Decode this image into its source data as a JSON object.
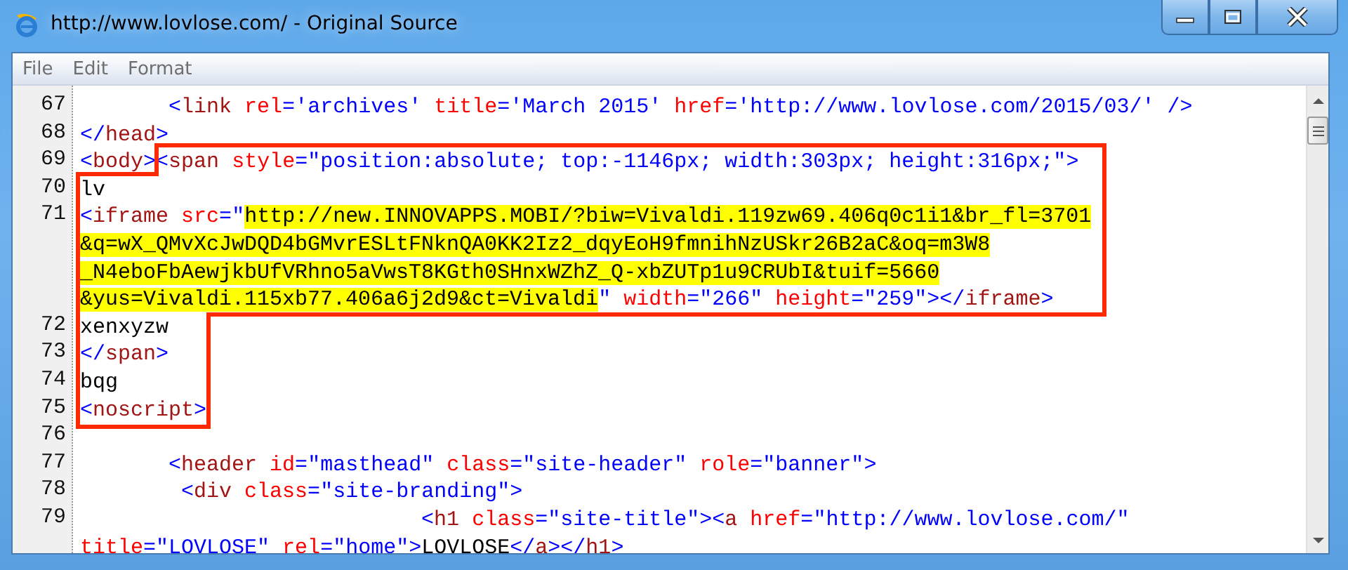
{
  "window": {
    "title": "http://www.lovlose.com/ - Original Source"
  },
  "menu": [
    "File",
    "Edit",
    "Format"
  ],
  "code_rows": [
    {
      "number": "67",
      "segments": [
        {
          "kind": "punct",
          "s": "<"
        },
        {
          "kind": "tag",
          "s": "link"
        },
        {
          "kind": "attr",
          "s": " rel"
        },
        {
          "kind": "punct",
          "s": "="
        },
        {
          "kind": "value",
          "s": "'archives'"
        },
        {
          "kind": "attr",
          "s": " title"
        },
        {
          "kind": "punct",
          "s": "="
        },
        {
          "kind": "value",
          "s": "'March 2015'"
        },
        {
          "kind": "attr",
          "s": " href"
        },
        {
          "kind": "punct",
          "s": "="
        },
        {
          "kind": "value",
          "s": "'http://www.lovlose.com/2015/03/'"
        },
        {
          "kind": "punct",
          "s": " />"
        }
      ]
    },
    {
      "number": "68",
      "segments": [
        {
          "kind": "punct",
          "s": "</"
        },
        {
          "kind": "tag",
          "s": "head"
        },
        {
          "kind": "punct",
          "s": ">"
        }
      ]
    },
    {
      "number": "69",
      "segments": [
        {
          "kind": "punct",
          "s": "<"
        },
        {
          "kind": "tag",
          "s": "body"
        },
        {
          "kind": "punct",
          "s": "><"
        },
        {
          "kind": "tag",
          "s": "span"
        },
        {
          "kind": "attr",
          "s": " style"
        },
        {
          "kind": "punct",
          "s": "="
        },
        {
          "kind": "value",
          "s": "\"position:absolute; top:-1146px; width:303px; height:316px;\""
        },
        {
          "kind": "punct",
          "s": ">"
        }
      ]
    },
    {
      "number": "70",
      "segments": [
        {
          "kind": "text",
          "s": "lv"
        }
      ]
    },
    {
      "number": "71",
      "segments": [
        {
          "kind": "punct",
          "s": "<"
        },
        {
          "kind": "tag",
          "s": "iframe"
        },
        {
          "kind": "attr",
          "s": " src"
        },
        {
          "kind": "punct",
          "s": "="
        },
        {
          "kind": "value",
          "s": "\""
        },
        {
          "kind": "highlight",
          "s": "http://new.INNOVAPPS.MOBI/?biw=Vivaldi.119zw69.406q0c1i1&br_fl=3701"
        }
      ]
    },
    {
      "segments": [
        {
          "kind": "highlight",
          "s": "&q=wX_QMvXcJwDQD4bGMvrESLtFNknQA0KK2Iz2_dqyEoH9fmnihNzUSkr26B2aC&oq=m3W8"
        }
      ]
    },
    {
      "segments": [
        {
          "kind": "highlight",
          "s": "_N4eboFbAewjkbUfVRhno5aVwsT8KGth0SHnxWZhZ_Q-xbZUTp1u9CRUbI&tuif=5660"
        }
      ]
    },
    {
      "segments": [
        {
          "kind": "highlight",
          "s": "&yus=Vivaldi.115xb77.406a6j2d9&ct=Vivaldi"
        },
        {
          "kind": "value",
          "s": "\""
        },
        {
          "kind": "attr",
          "s": " width"
        },
        {
          "kind": "punct",
          "s": "="
        },
        {
          "kind": "value",
          "s": "\"266\""
        },
        {
          "kind": "attr",
          "s": " height"
        },
        {
          "kind": "punct",
          "s": "="
        },
        {
          "kind": "value",
          "s": "\"259\""
        },
        {
          "kind": "punct",
          "s": "></"
        },
        {
          "kind": "tag",
          "s": "iframe"
        },
        {
          "kind": "punct",
          "s": ">"
        }
      ]
    },
    {
      "number": "72",
      "segments": [
        {
          "kind": "text",
          "s": "xenxyzw"
        }
      ]
    },
    {
      "number": "73",
      "segments": [
        {
          "kind": "punct",
          "s": "</"
        },
        {
          "kind": "tag",
          "s": "span"
        },
        {
          "kind": "punct",
          "s": ">"
        }
      ]
    },
    {
      "number": "74",
      "segments": [
        {
          "kind": "text",
          "s": "bqg"
        }
      ]
    },
    {
      "number": "75",
      "segments": [
        {
          "kind": "punct",
          "s": "<"
        },
        {
          "kind": "tag",
          "s": "noscript"
        },
        {
          "kind": "punct",
          "s": ">"
        }
      ]
    },
    {
      "number": "76"
    },
    {
      "number": "77",
      "segments": [
        {
          "kind": "punct",
          "s": "<"
        },
        {
          "kind": "tag",
          "s": "header"
        },
        {
          "kind": "attr",
          "s": " id"
        },
        {
          "kind": "punct",
          "s": "="
        },
        {
          "kind": "value",
          "s": "\"masthead\""
        },
        {
          "kind": "attr",
          "s": " class"
        },
        {
          "kind": "punct",
          "s": "="
        },
        {
          "kind": "value",
          "s": "\"site-header\""
        },
        {
          "kind": "attr",
          "s": " role"
        },
        {
          "kind": "punct",
          "s": "="
        },
        {
          "kind": "value",
          "s": "\"banner\""
        },
        {
          "kind": "punct",
          "s": ">"
        }
      ]
    },
    {
      "number": "78",
      "segments": [
        {
          "kind": "punct",
          "s": "<"
        },
        {
          "kind": "tag",
          "s": "div"
        },
        {
          "kind": "attr",
          "s": " class"
        },
        {
          "kind": "punct",
          "s": "="
        },
        {
          "kind": "value",
          "s": "\"site-branding\""
        },
        {
          "kind": "punct",
          "s": ">"
        }
      ]
    },
    {
      "number": "79",
      "segments": [
        {
          "kind": "punct",
          "s": "<"
        },
        {
          "kind": "tag",
          "s": "h1"
        },
        {
          "kind": "attr",
          "s": " class"
        },
        {
          "kind": "punct",
          "s": "="
        },
        {
          "kind": "value",
          "s": "\"site-title\""
        },
        {
          "kind": "punct",
          "s": "><"
        },
        {
          "kind": "tag",
          "s": "a"
        },
        {
          "kind": "attr",
          "s": " href"
        },
        {
          "kind": "punct",
          "s": "="
        },
        {
          "kind": "value",
          "s": "\"http://www.lovlose.com/\""
        }
      ]
    },
    {
      "segments": [
        {
          "kind": "attr",
          "s": "title"
        },
        {
          "kind": "punct",
          "s": "="
        },
        {
          "kind": "value",
          "s": "\"LOVLOSE\""
        },
        {
          "kind": "attr",
          "s": " rel"
        },
        {
          "kind": "punct",
          "s": "="
        },
        {
          "kind": "value",
          "s": "\"home\""
        },
        {
          "kind": "punct",
          "s": ">"
        },
        {
          "kind": "text",
          "s": "LOVLOSE"
        },
        {
          "kind": "punct",
          "s": "</"
        },
        {
          "kind": "tag",
          "s": "a"
        },
        {
          "kind": "punct",
          "s": "></"
        },
        {
          "kind": "tag",
          "s": "h1"
        },
        {
          "kind": "punct",
          "s": ">"
        }
      ]
    }
  ]
}
